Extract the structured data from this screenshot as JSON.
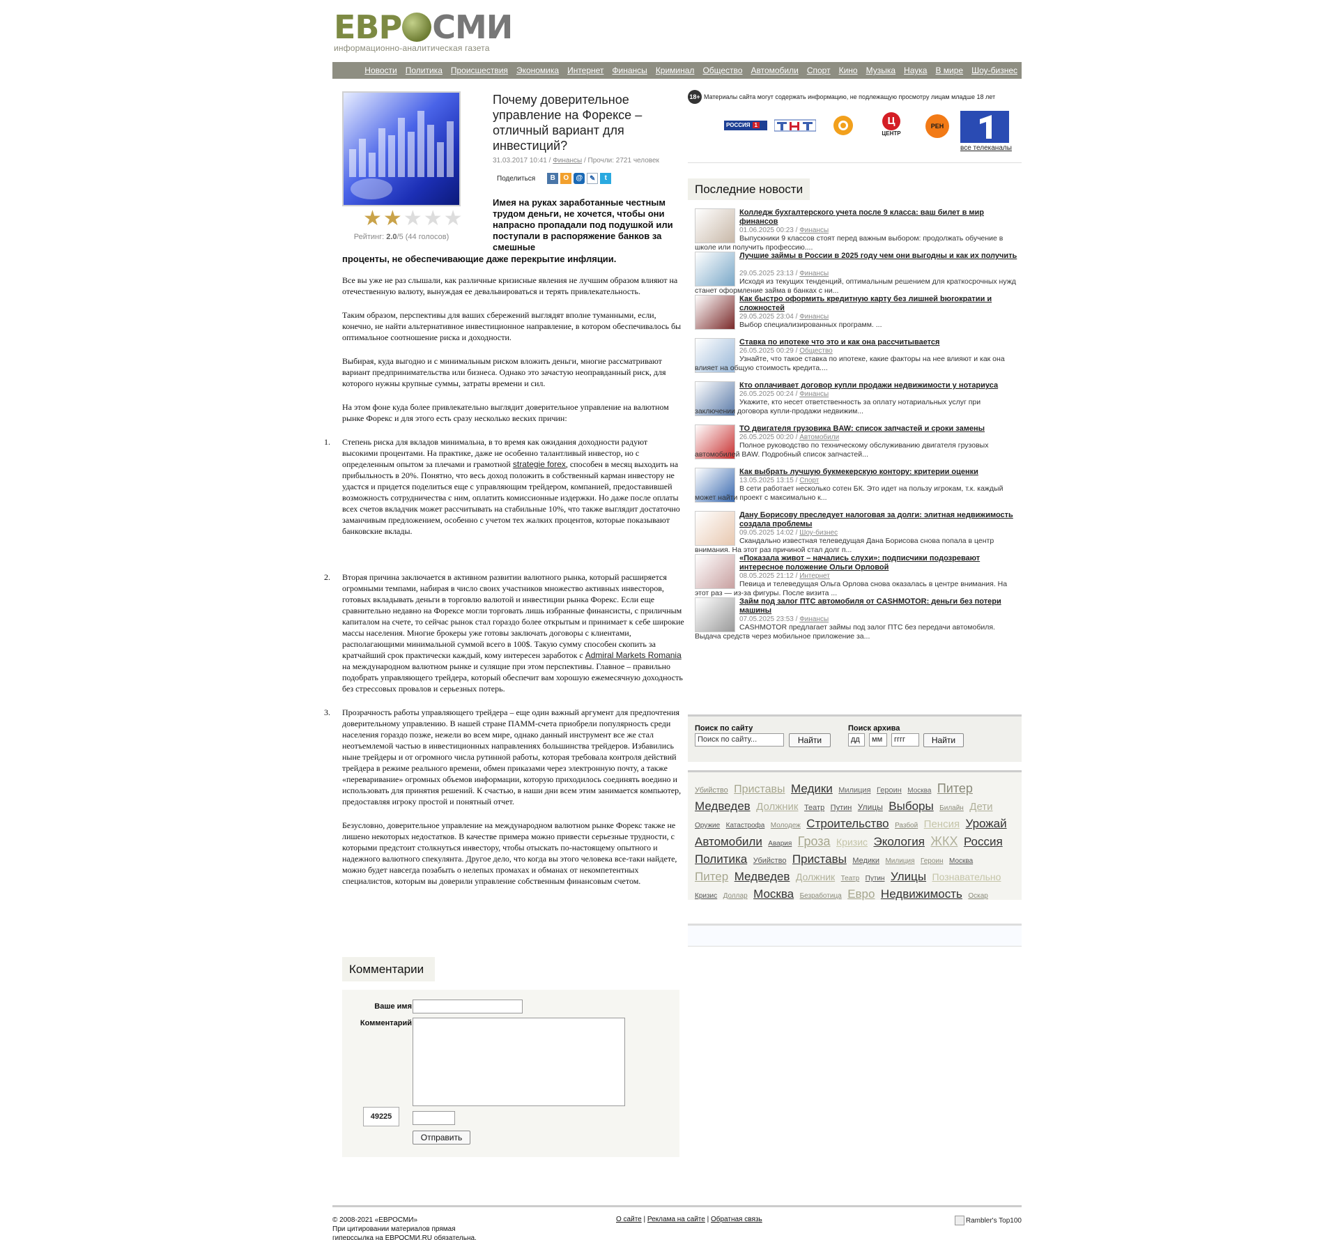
{
  "logo": {
    "part1": "ЕВР",
    "part2": "СМИ",
    "subtitle": "информационно-аналитическая газета"
  },
  "nav": [
    "Новости",
    "Политика",
    "Происшествия",
    "Экономика",
    "Интернет",
    "Финансы",
    "Криминал",
    "Общество",
    "Автомобили",
    "Спорт",
    "Кино",
    "Музыка",
    "Наука",
    "В мире",
    "Шоу-бизнес"
  ],
  "article": {
    "title": "Почему доверительное управление на Форексе – отличный вариант для инвестиций?",
    "date": "31.03.2017 10:41",
    "sep1": " / ",
    "category": "Финансы",
    "reads": " / Прочли: 2721 человек",
    "share_label": "Поделиться",
    "rating_label": "Рейтинг: ",
    "rating_value": "2.0",
    "rating_rest": "/5 (44 голосов)",
    "rating_stars": 2,
    "lead_a": "Имея на руках заработанные честным трудом деньги, не хочется, чтобы они напрасно пропадали под подушкой или поступали в распоряжение банков за смешные",
    "lead_b": "проценты, не обеспечивающие даже перекрытие инфляции.",
    "p1": "Все вы уже не раз слышали, как различные кризисные явления не лучшим образом влияют на отечественную валюту, вынуждая ее девальвироваться и терять привлекательность.",
    "p2": "Таким образом, перспективы для ваших сбережений выглядят вполне туманными, если, конечно, не найти альтернативное инвестиционное направление, в котором обеспечивалось бы оптимальное соотношение риска и доходности.",
    "p3": "Выбирая, куда выгодно и с минимальным риском вложить деньги, многие рассматривают вариант предпринимательства или бизнеса. Однако это зачастую неоправданный риск, для которого нужны крупные суммы, затраты времени и сил.",
    "p4": "На этом фоне куда более привлекательно выглядит доверительное управление на валютном рынке Форекс и для этого есть сразу несколько веских причин:",
    "li1_a": "Степень риска для вкладов минимальна, в то время как ожидания доходности радуют высокими процентами. На практике, даже не особенно талантливый инвестор, но с определенным опытом за плечами и грамотной ",
    "li1_link": "strategie forex",
    "li1_b": ", способен в месяц выходить на прибыльность в 20%. Понятно, что весь доход положить в собственный карман инвестору не удастся и придется поделиться еще с управляющим трейдером, компанией, предоставившей возможность сотрудничества с ним, оплатить комиссионные издержки. Но даже после оплаты всех счетов вкладчик может рассчитывать на стабильные 10%, что также выглядит достаточно заманчивым предложением, особенно с учетом тех жалких процентов, которые показывают банковские вклады.",
    "li2_a": "Вторая причина заключается в активном развитии валютного рынка, который расширяется огромными темпами, набирая в число своих участников множество активных инвесторов, готовых вкладывать деньги в торговлю валютой и инвестиции рынка Форекс. Если еще сравнительно недавно на Форексе могли торговать лишь избранные финансисты, с приличным капиталом на счете, то сейчас рынок стал гораздо более открытым и принимает к себе широкие массы населения. Многие брокеры уже готовы заключать договоры с клиентами, располагающими минимальной суммой всего в 100$. Такую сумму способен скопить за кратчайший срок практически каждый, кому интересен заработок с ",
    "li2_link": "Admiral Markets Romania",
    "li2_b": " на международном валютном рынке и сулящие при этом перспективы. Главное – правильно подобрать управляющего трейдера, который обеспечит вам хорошую ежемесячную доходность без стрессовых провалов и серьезных потерь.",
    "li3": "Прозрачность работы управляющего трейдера – еще один важный аргумент для предпочтения доверительному управлению. В нашей стране ПАММ-счета приобрели популярность среди населения гораздо позже, нежели во всем мире, однако данный инструмент все же стал неотъемлемой частью в инвестиционных направлениях большинства трейдеров. Избавились ныне трейдеры и от огромного числа рутинной работы, которая требовала контроля действий трейдера в режиме реального времени, обмен приказами через электронную почту, а также «переваривание» огромных объемов информации, которую приходилось соединять воедино и использовать для принятия решений. К счастью, в наши дни всем этим занимается компьютер, предоставляя игроку простой и понятный отчет.",
    "p5": "Безусловно, доверительное управление на международном валютном рынке Форекс также не лишено некоторых недостатков. В качестве примера можно привести серьезные трудности, с которыми предстоит столкнуться инвестору, чтобы отыскать по-настоящему опытного и надежного валютного спекулянта. Другое дело, что когда вы этого человека все-таки найдете, можно будет навсегда позабыть о нелепых промахах и обманах от некомпетентных специалистов, которым вы доверили управление собственным финансовым счетом."
  },
  "comments": {
    "title": "Комментарии",
    "name_label": "Ваше имя",
    "comment_label": "Комментарий",
    "captcha": "49225",
    "submit": "Отправить"
  },
  "age_notice": {
    "badge": "18+",
    "text": "Материалы сайта могут содержать информацию, не подлежащую просмотру лицам младше 18 лет"
  },
  "tv": {
    "rossiya": "РОССИЯ",
    "rossiya_num": "1",
    "tsentr": "ЦЕНТР",
    "ren": "РЕН",
    "all": "все телеканалы"
  },
  "latest": {
    "title": "Последние новости",
    "items": [
      {
        "title": "Колледж бухгалтерского учета после 9 класса: ваш билет в мир финансов",
        "date": "01.06.2025 00:23 / ",
        "cat": "Финансы",
        "excerpt": "Выпускники 9 классов стоят перед важным выбором: продолжать обучение в школе или получить профессию...."
      },
      {
        "title": "Лучшие займы в России в 2025 году чем они выгодны и как их получить",
        "date": "29.05.2025 23:13 / ",
        "cat": "Финансы",
        "excerpt": "Исходя из текущих тенденций, оптимальным решением для краткосрочных нужд станет оформление займа в банках с ни..."
      },
      {
        "title": "Как быстро оформить кредитную карту без лишней bюrократии и сложностей",
        "date": "29.05.2025 23:04 / ",
        "cat": "Финансы",
        "excerpt": "Выбор специализированных программ. ..."
      },
      {
        "title": "Ставка по ипотеке что это и как она рассчитывается",
        "date": "26.05.2025 00:29 / ",
        "cat": "Общество",
        "excerpt": "Узнайте, что такое ставка по ипотеке, какие факторы на нее влияют и как она влияет на общую стоимость кредита...."
      },
      {
        "title": "Кто оплачивает договор купли продажи недвижимости у нотариуса",
        "date": "26.05.2025 00:24 / ",
        "cat": "Финансы",
        "excerpt": "Укажите, кто несет ответственность за оплату нотариальных услуг при заключении договора купли-продажи недвижим..."
      },
      {
        "title": "ТО двигателя грузовика BAW: список запчастей и сроки замены",
        "date": "26.05.2025 00:20 / ",
        "cat": "Автомобили",
        "excerpt": "Полное руководство по техническому обслуживанию двигателя грузовых автомобилей BAW. Подробный список запчастей..."
      },
      {
        "title": "Как выбрать лучшую букмекерскую контору: критерии оценки",
        "date": "13.05.2025 13:15 / ",
        "cat": "Спорт",
        "excerpt": "В сети работает несколько сотен БК. Это идет на пользу игрокам, т.к. каждый может найти проект с максимально к..."
      },
      {
        "title": "Дану Борисову преследует налоговая за долги: элитная недвижимость создала проблемы",
        "date": "09.05.2025 14:02 / ",
        "cat": "Шоу-бизнес",
        "excerpt": "Скандально известная телеведущая Дана Борисова снова попала в центр внимания. На этот раз причиной стал долг п..."
      },
      {
        "title": "«Показала живот – начались слухи»: подписчики подозревают интересное положение Ольги Орловой",
        "date": "08.05.2025 21:12 / ",
        "cat": "Интернет",
        "excerpt": "Певица и телеведущая Ольга Орлова снова оказалась в центре внимания. На этот раз — из-за фигуры. После визита ..."
      },
      {
        "title": "Займ под залог ПТС автомобиля от CASHMOTOR: деньги без потери машины",
        "date": "07.05.2025 23:53 / ",
        "cat": "Финансы",
        "excerpt": "CASHMOTOR предлагает займы под залог ПТС без передачи автомобиля. Выдача средств через мобильное приложение за..."
      }
    ]
  },
  "search": {
    "site_label": "Поиск по сайту",
    "site_placeholder": "Поиск по сайту...",
    "site_btn": "Найти",
    "archive_label": "Поиск архива",
    "dd": "дд",
    "mm": "мм",
    "yyyy": "гггг",
    "archive_btn": "Найти"
  },
  "tags": [
    {
      "t": "Убийство",
      "s": 11,
      "c": "#8a8a7a"
    },
    {
      "t": "Приставы",
      "s": 16,
      "c": "#a6a68e"
    },
    {
      "t": "Медики",
      "s": 17,
      "c": "#333"
    },
    {
      "t": "Милиция",
      "s": 11,
      "c": "#666"
    },
    {
      "t": "Героин",
      "s": 11,
      "c": "#666"
    },
    {
      "t": "Москва",
      "s": 10,
      "c": "#666"
    },
    {
      "t": "Питер",
      "s": 18,
      "c": "#8a8a7a"
    },
    {
      "t": "Медведев",
      "s": 17,
      "c": "#333"
    },
    {
      "t": "Должник",
      "s": 15,
      "c": "#b0b09a"
    },
    {
      "t": "Театр",
      "s": 11,
      "c": "#555"
    },
    {
      "t": "Путин",
      "s": 11,
      "c": "#555"
    },
    {
      "t": "Улицы",
      "s": 12,
      "c": "#555"
    },
    {
      "t": "Выборы",
      "s": 17,
      "c": "#333"
    },
    {
      "t": "Билайн",
      "s": 10,
      "c": "#8a8a7a"
    },
    {
      "t": "Дети",
      "s": 15,
      "c": "#b0b09a"
    },
    {
      "t": "Оружие",
      "s": 10,
      "c": "#555"
    },
    {
      "t": "Катастрофа",
      "s": 10,
      "c": "#555"
    },
    {
      "t": "Молодеж",
      "s": 10,
      "c": "#8a8a7a"
    },
    {
      "t": "Строительство",
      "s": 17,
      "c": "#333"
    },
    {
      "t": "Разбой",
      "s": 10,
      "c": "#8a8a7a"
    },
    {
      "t": "Пенсия",
      "s": 15,
      "c": "#c4c4a8"
    },
    {
      "t": "Урожай",
      "s": 17,
      "c": "#333"
    },
    {
      "t": "Автомобили",
      "s": 17,
      "c": "#333"
    },
    {
      "t": "Авария",
      "s": 10,
      "c": "#555"
    },
    {
      "t": "Гроза",
      "s": 18,
      "c": "#a6a68e"
    },
    {
      "t": "Кризис",
      "s": 14,
      "c": "#c4c4a8"
    },
    {
      "t": "Экология",
      "s": 17,
      "c": "#333"
    },
    {
      "t": "ЖКХ",
      "s": 18,
      "c": "#b0b09a"
    },
    {
      "t": "Россия",
      "s": 17,
      "c": "#333"
    },
    {
      "t": "Политика",
      "s": 17,
      "c": "#333"
    },
    {
      "t": "Убийство",
      "s": 11,
      "c": "#555"
    },
    {
      "t": "Приставы",
      "s": 17,
      "c": "#333"
    },
    {
      "t": "Медики",
      "s": 11,
      "c": "#555"
    },
    {
      "t": "Милиция",
      "s": 10,
      "c": "#8a8a7a"
    },
    {
      "t": "Героин",
      "s": 10,
      "c": "#8a8a7a"
    },
    {
      "t": "Москва",
      "s": 10,
      "c": "#555"
    },
    {
      "t": "Питер",
      "s": 17,
      "c": "#a6a68e"
    },
    {
      "t": "Медведев",
      "s": 17,
      "c": "#333"
    },
    {
      "t": "Должник",
      "s": 14,
      "c": "#b0b09a"
    },
    {
      "t": "Театр",
      "s": 10,
      "c": "#8a8a7a"
    },
    {
      "t": "Путин",
      "s": 10,
      "c": "#555"
    },
    {
      "t": "Улицы",
      "s": 17,
      "c": "#333"
    },
    {
      "t": "Познавательно",
      "s": 14,
      "c": "#c4c4a8"
    },
    {
      "t": "Кризис",
      "s": 10,
      "c": "#555"
    },
    {
      "t": "Доллар",
      "s": 10,
      "c": "#8a8a7a"
    },
    {
      "t": "Москва",
      "s": 17,
      "c": "#333"
    },
    {
      "t": "Безработица",
      "s": 10,
      "c": "#8a8a7a"
    },
    {
      "t": "Евро",
      "s": 17,
      "c": "#a6a68e"
    },
    {
      "t": "Недвижимость",
      "s": 17,
      "c": "#333"
    },
    {
      "t": "Оскар",
      "s": 10,
      "c": "#8a8a7a"
    }
  ],
  "footer": {
    "copy1": "© 2008-2021 «ЕВРОСМИ»",
    "copy2": "При цитировании материалов прямая",
    "copy3": "гиперссылка на ЕВРОСМИ.RU обязательна.",
    "about": "О сайте",
    "ads": "Реклама на сайте",
    "feedback": "Обратная связь",
    "rambler": "Rambler's Top100"
  }
}
